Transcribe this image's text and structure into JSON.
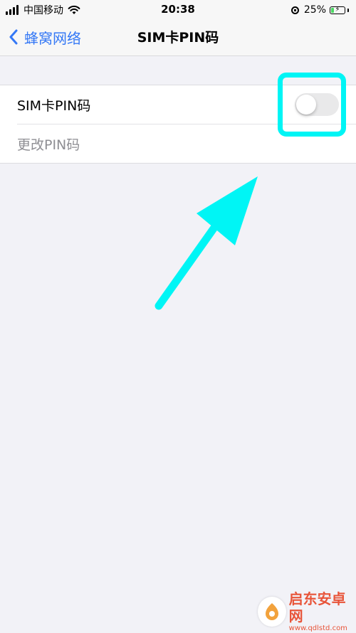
{
  "status_bar": {
    "carrier": "中国移动",
    "time": "20:38",
    "battery_percent": "25%",
    "battery_level": 0.25,
    "icons": [
      "signal-bars-icon",
      "wifi-icon",
      "rotation-lock-icon",
      "battery-charging-icon"
    ]
  },
  "nav": {
    "back_label": "蜂窝网络",
    "title": "SIM卡PIN码"
  },
  "settings": {
    "sim_pin_label": "SIM卡PIN码",
    "sim_pin_enabled": false,
    "change_pin_label": "更改PIN码"
  },
  "annotation": {
    "color": "#00f5f5"
  },
  "watermark": {
    "name": "启东安卓网",
    "url": "www.qdlstd.com"
  },
  "colors": {
    "accent": "#3478f6",
    "background": "#f2f2f7",
    "toggle_off": "#e9e9ea",
    "disabled_text": "#8e8e93"
  }
}
